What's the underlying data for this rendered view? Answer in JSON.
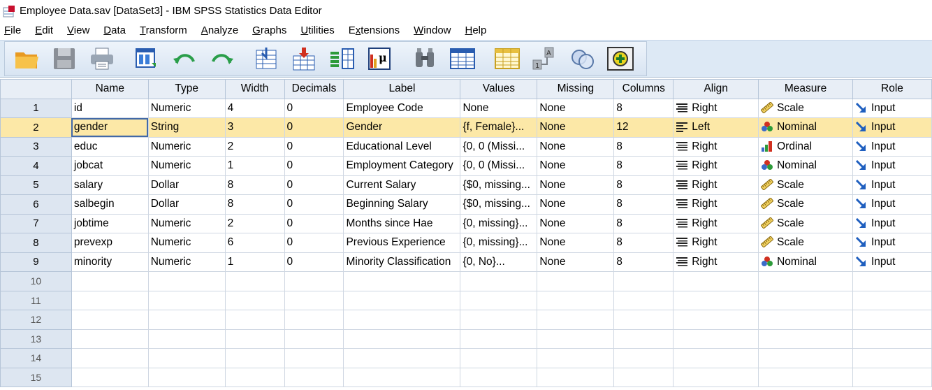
{
  "window": {
    "title": "Employee Data.sav [DataSet3] - IBM SPSS Statistics Data Editor"
  },
  "menu": [
    {
      "label": "File",
      "mnemonic": "F",
      "rest": "ile"
    },
    {
      "label": "Edit",
      "mnemonic": "E",
      "rest": "dit"
    },
    {
      "label": "View",
      "mnemonic": "V",
      "rest": "iew"
    },
    {
      "label": "Data",
      "mnemonic": "D",
      "rest": "ata"
    },
    {
      "label": "Transform",
      "mnemonic": "T",
      "rest": "ransform"
    },
    {
      "label": "Analyze",
      "mnemonic": "A",
      "rest": "nalyze"
    },
    {
      "label": "Graphs",
      "mnemonic": "G",
      "rest": "raphs"
    },
    {
      "label": "Utilities",
      "mnemonic": "U",
      "rest": "tilities"
    },
    {
      "label": "Extensions",
      "mnemonic": "x",
      "pre": "E",
      "rest": "tensions"
    },
    {
      "label": "Window",
      "mnemonic": "W",
      "rest": "indow"
    },
    {
      "label": "Help",
      "mnemonic": "H",
      "rest": "elp"
    }
  ],
  "toolbar": {
    "buttons": [
      "open-folder-icon",
      "save-icon",
      "print-icon",
      "recall-dialog-icon",
      "undo-icon",
      "redo-icon",
      "goto-case-icon",
      "goto-variable-icon",
      "variables-icon",
      "run-descriptive-icon",
      "find-icon",
      "insert-cases-icon",
      "insert-variable-icon",
      "split-file-icon",
      "value-labels-icon",
      "use-variable-sets-icon"
    ]
  },
  "grid": {
    "columns": [
      "Name",
      "Type",
      "Width",
      "Decimals",
      "Label",
      "Values",
      "Missing",
      "Columns",
      "Align",
      "Measure",
      "Role"
    ],
    "rows": [
      {
        "n": "1",
        "name": "id",
        "type": "Numeric",
        "width": "4",
        "decimals": "0",
        "label": "Employee Code",
        "values": "None",
        "missing": "None",
        "columns": "8",
        "align": "Right",
        "align_icon": "align-right-icon",
        "measure": "Scale",
        "measure_icon": "scale-ruler-icon",
        "role": "Input"
      },
      {
        "n": "2",
        "name": "gender",
        "type": "String",
        "width": "3",
        "decimals": "0",
        "label": "Gender",
        "values": "{f, Female}...",
        "missing": "None",
        "columns": "12",
        "align": "Left",
        "align_icon": "align-left-icon",
        "measure": "Nominal",
        "measure_icon": "nominal-circles-icon",
        "role": "Input"
      },
      {
        "n": "3",
        "name": "educ",
        "type": "Numeric",
        "width": "2",
        "decimals": "0",
        "label": "Educational Level",
        "values": "{0, 0 (Missi...",
        "missing": "None",
        "columns": "8",
        "align": "Right",
        "align_icon": "align-right-icon",
        "measure": "Ordinal",
        "measure_icon": "ordinal-bars-icon",
        "role": "Input"
      },
      {
        "n": "4",
        "name": "jobcat",
        "type": "Numeric",
        "width": "1",
        "decimals": "0",
        "label": "Employment Category",
        "values": "{0, 0 (Missi...",
        "missing": "None",
        "columns": "8",
        "align": "Right",
        "align_icon": "align-right-icon",
        "measure": "Nominal",
        "measure_icon": "nominal-circles-icon",
        "role": "Input"
      },
      {
        "n": "5",
        "name": "salary",
        "type": "Dollar",
        "width": "8",
        "decimals": "0",
        "label": "Current Salary",
        "values": "{$0, missing...",
        "missing": "None",
        "columns": "8",
        "align": "Right",
        "align_icon": "align-right-icon",
        "measure": "Scale",
        "measure_icon": "scale-ruler-icon",
        "role": "Input"
      },
      {
        "n": "6",
        "name": "salbegin",
        "type": "Dollar",
        "width": "8",
        "decimals": "0",
        "label": "Beginning Salary",
        "values": "{$0, missing...",
        "missing": "None",
        "columns": "8",
        "align": "Right",
        "align_icon": "align-right-icon",
        "measure": "Scale",
        "measure_icon": "scale-ruler-icon",
        "role": "Input"
      },
      {
        "n": "7",
        "name": "jobtime",
        "type": "Numeric",
        "width": "2",
        "decimals": "0",
        "label": "Months since Hae",
        "values": "{0, missing}...",
        "missing": "None",
        "columns": "8",
        "align": "Right",
        "align_icon": "align-right-icon",
        "measure": "Scale",
        "measure_icon": "scale-ruler-icon",
        "role": "Input"
      },
      {
        "n": "8",
        "name": "prevexp",
        "type": "Numeric",
        "width": "6",
        "decimals": "0",
        "label": "Previous Experience",
        "values": "{0, missing}...",
        "missing": "None",
        "columns": "8",
        "align": "Right",
        "align_icon": "align-right-icon",
        "measure": "Scale",
        "measure_icon": "scale-ruler-icon",
        "role": "Input"
      },
      {
        "n": "9",
        "name": "minority",
        "type": "Numeric",
        "width": "1",
        "decimals": "0",
        "label": "Minority Classification",
        "values": "{0, No}...",
        "missing": "None",
        "columns": "8",
        "align": "Right",
        "align_icon": "align-right-icon",
        "measure": "Nominal",
        "measure_icon": "nominal-circles-icon",
        "role": "Input"
      }
    ],
    "empty_rows": [
      "10",
      "11",
      "12",
      "13",
      "14",
      "15"
    ],
    "selected_row": 1
  },
  "colors": {
    "selected_row": "#fce8a7",
    "header": "#e8eef6",
    "toolbar": "#dde9f5",
    "role_arrow": "#1f5fbf"
  }
}
